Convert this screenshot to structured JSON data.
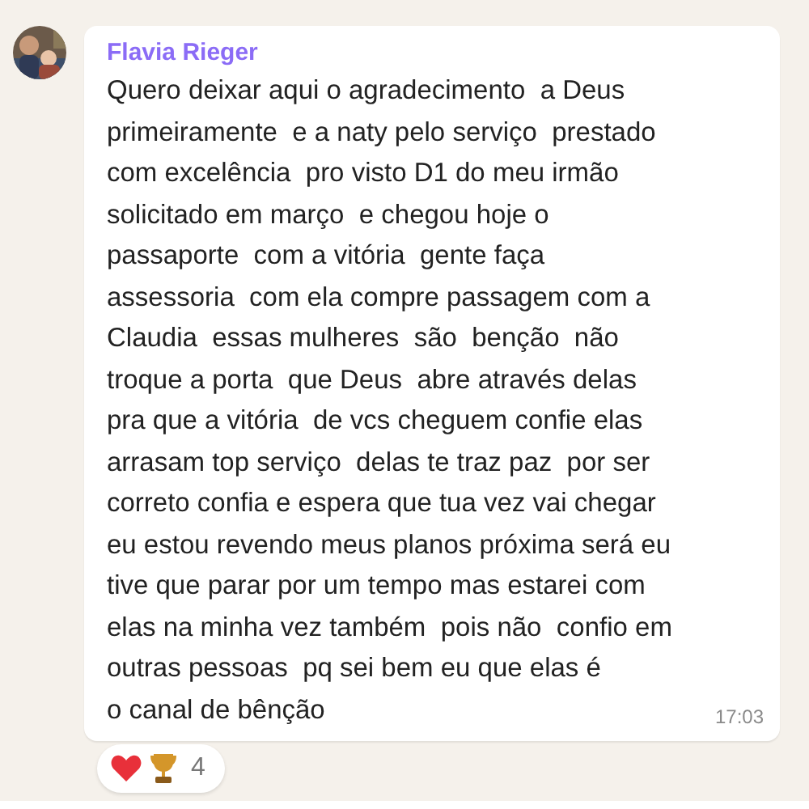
{
  "message": {
    "sender": "Flavia Rieger",
    "lines": [
      "Quero deixar aqui o agradecimento  a Deus",
      "primeiramente  e a naty pelo serviço  prestado",
      "com excelência  pro visto D1 do meu irmão",
      "solicitado em março  e chegou hoje o",
      "passaporte  com a vitória  gente faça",
      "assessoria  com ela compre passagem com a",
      "Claudia  essas mulheres  são  benção  não",
      "troque a porta  que Deus  abre através delas",
      "pra que a vitória  de vcs cheguem confie elas",
      "arrasam top serviço  delas te traz paz  por ser",
      "correto confia e espera que tua vez vai chegar",
      "eu estou revendo meus planos próxima será eu",
      "tive que parar por um tempo mas estarei com",
      "elas na minha vez também  pois não  confio em",
      "outras pessoas  pq sei bem eu que elas é",
      "o canal de bênção"
    ],
    "time": "17:03",
    "reactions": {
      "count": "4"
    }
  }
}
